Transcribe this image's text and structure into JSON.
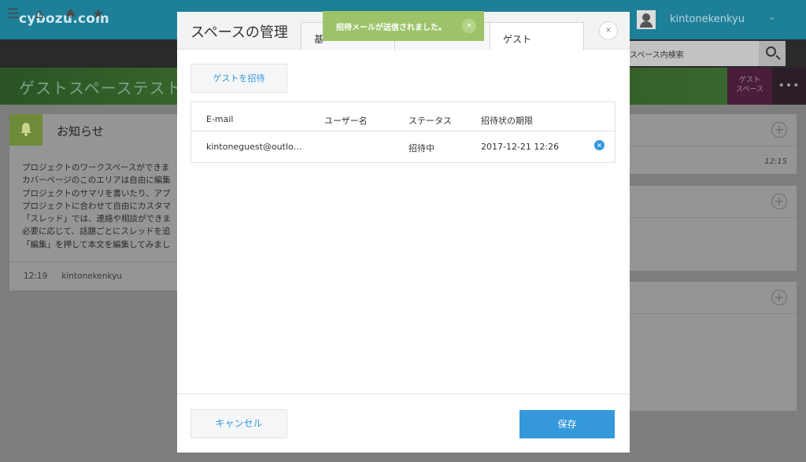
{
  "app": {
    "logo": "cybozu.com",
    "user_name": "kintonekenkyu",
    "user_caret": "⌄",
    "search_placeholder": "スペース内検索",
    "space_title": "ゲストスペーステスト",
    "guest_space_badge": "ゲスト\nスペース",
    "more_label": "•••"
  },
  "notice": {
    "title": "お知らせ",
    "body_lines": [
      "プロジェクトのワークスペースができま",
      "カバーページのこのエリアは自由に編集",
      "プロジェクトのサマリを書いたり、アプ",
      "プロジェクトに合わせて自由にカスタマ",
      "「スレッド」では、連絡や相談ができま",
      "必要に応じて、話題ごとにスレッドを追",
      "「編集」を押して本文を編集してみまし"
    ],
    "time": "12:19",
    "author": "kintonekenkyu"
  },
  "right_cards": [
    {
      "time": "12:15"
    },
    {
      "time": ""
    },
    {
      "time": ""
    }
  ],
  "modal": {
    "title": "スペースの管理",
    "tabs": [
      "基",
      "",
      "ゲスト"
    ],
    "close": "×",
    "toast": {
      "text": "招待メールが送信されました。",
      "close": "×"
    },
    "invite_label": "ゲストを招待",
    "table": {
      "headers": [
        "E-mail",
        "ユーザー名",
        "ステータス",
        "招待状の期限"
      ],
      "rows": [
        {
          "email": "kintoneguest@outlo…",
          "username": "",
          "status": "招待中",
          "expiry": "2017-12-21 12:26"
        }
      ]
    },
    "cancel_label": "キャンセル",
    "save_label": "保存"
  },
  "colors": {
    "topbar": "#1e7f98",
    "accent": "#3498db",
    "toast": "#9cc36a"
  }
}
